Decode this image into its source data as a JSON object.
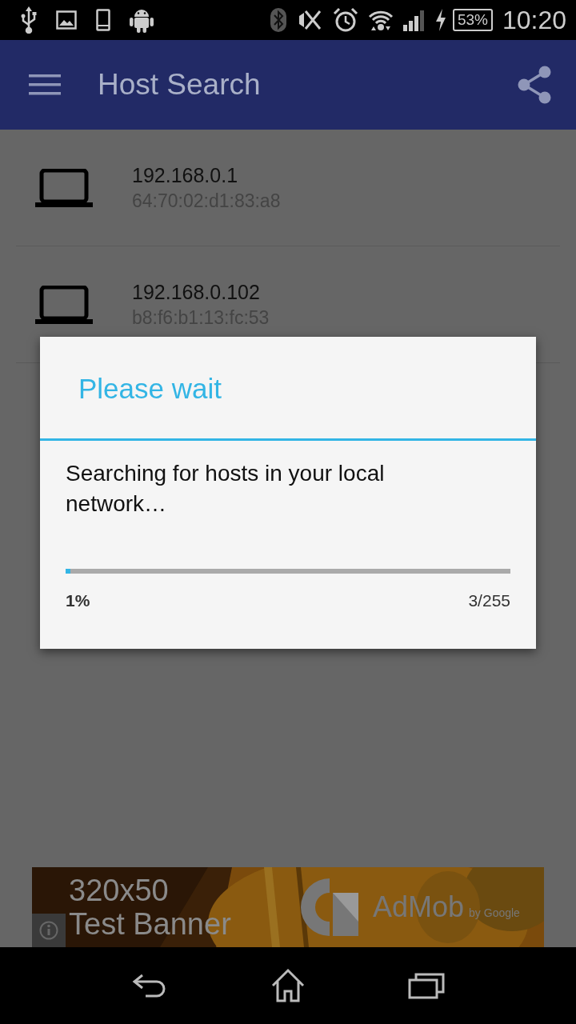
{
  "status_bar": {
    "battery": "53%",
    "time": "10:20"
  },
  "app_bar": {
    "title": "Host Search"
  },
  "hosts": [
    {
      "ip": "192.168.0.1",
      "mac": "64:70:02:d1:83:a8"
    },
    {
      "ip": "192.168.0.102",
      "mac": "b8:f6:b1:13:fc:53"
    }
  ],
  "dialog": {
    "title": "Please wait",
    "message": "Searching for hosts in your local network…",
    "progress": {
      "level": 0.01,
      "percent": "1%",
      "count": "3/255"
    }
  },
  "ad_banner": {
    "size_text": "320x50",
    "label": "Test Banner",
    "brand": "AdMob",
    "byline": "by Google"
  }
}
